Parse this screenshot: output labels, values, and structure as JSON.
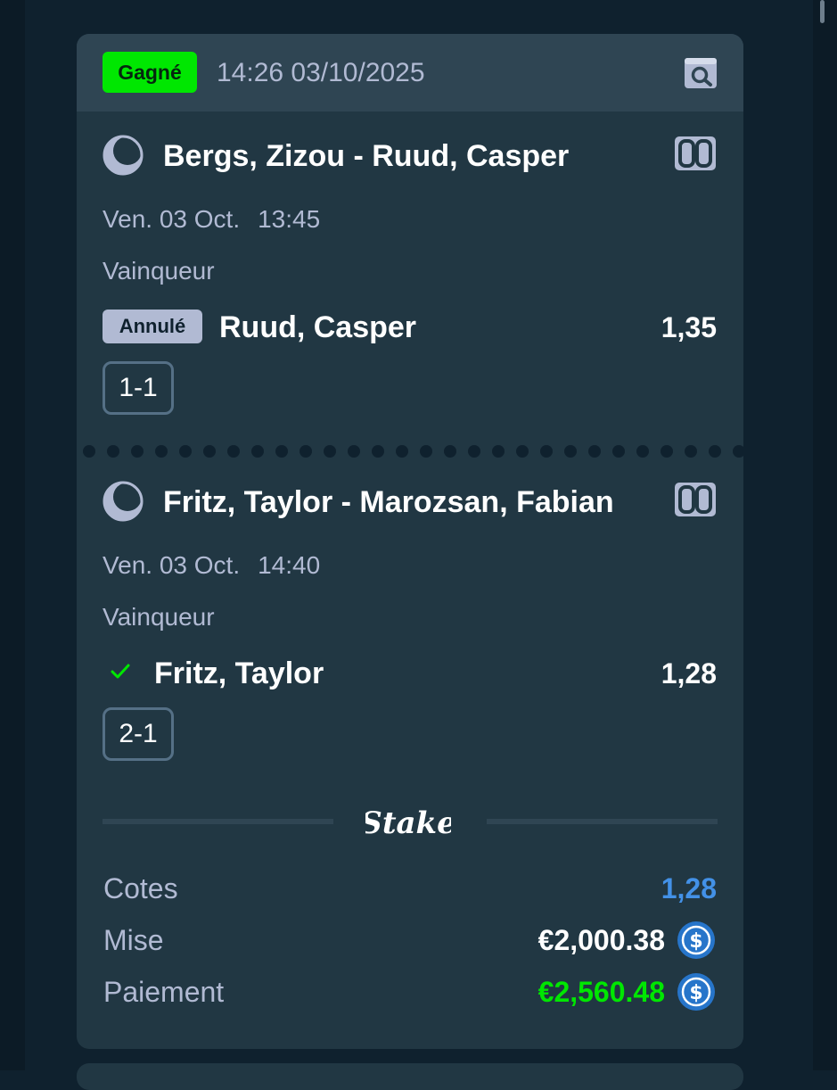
{
  "bet": {
    "status_label": "Gagné",
    "datetime": "14:26 03/10/2025",
    "icons": {
      "search": "receipt-search-icon",
      "sport": "tennis-ball-icon",
      "stats": "scoreboard-icon",
      "check": "checkmark-icon",
      "coin": "usdc-coin-icon"
    },
    "colors": {
      "won": "#00e701",
      "odds_total": "#4391e7",
      "payout": "#00e701",
      "card": "#213743",
      "header": "#2f4553"
    }
  },
  "selections": [
    {
      "match": "Bergs, Zizou - Ruud, Casper",
      "date": "Ven. 03 Oct.",
      "time": "13:45",
      "market": "Vainqueur",
      "status_badge": "Annulé",
      "outcome": "Ruud, Casper",
      "odds": "1,35",
      "score": "1-1"
    },
    {
      "match": "Fritz, Taylor - Marozsan, Fabian",
      "date": "Ven. 03 Oct.",
      "time": "14:40",
      "market": "Vainqueur",
      "status_badge": "",
      "outcome": "Fritz, Taylor",
      "odds": "1,28",
      "score": "2-1"
    }
  ],
  "brand": {
    "logo_text": "Stake"
  },
  "summary": {
    "odds_label": "Cotes",
    "odds_value": "1,28",
    "stake_label": "Mise",
    "stake_value": "€2,000.38",
    "payout_label": "Paiement",
    "payout_value": "€2,560.48"
  }
}
